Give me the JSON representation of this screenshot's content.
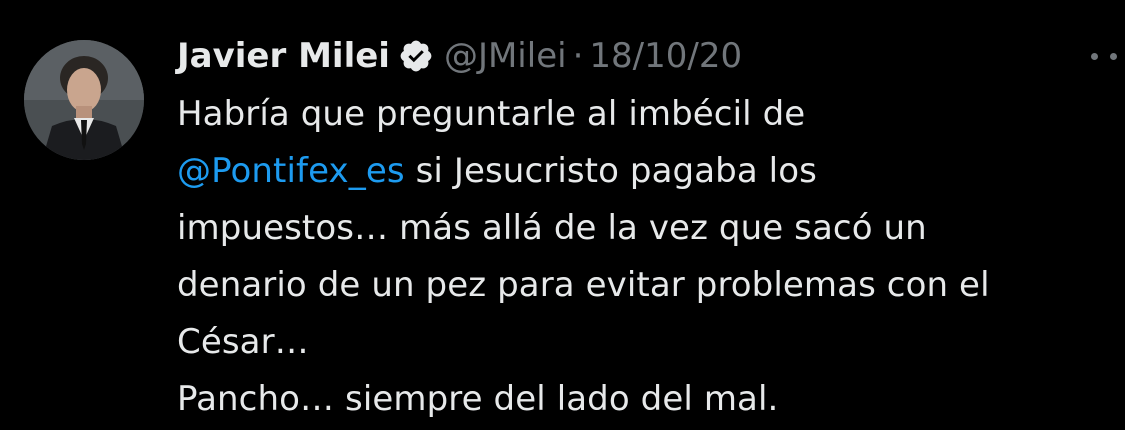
{
  "author": {
    "name": "Javier Milei",
    "handle": "@JMilei",
    "separator": "·",
    "date": "18/10/20",
    "verified_icon": "verified-badge-icon",
    "avatar": "avatar-photo"
  },
  "menu": {
    "icon": "more-options-icon"
  },
  "tweet": {
    "line1": "Habría que preguntarle al imbécil de",
    "line2_mention": "@Pontifex_es",
    "line2_rest": " si Jesucristo pagaba los",
    "line3": "impuestos… más allá de la vez que sacó un",
    "line4": "denario de un pez para evitar problemas con el",
    "line5": "César…",
    "line6": "Pancho… siempre del lado del mal."
  },
  "colors": {
    "background": "#000000",
    "text": "#e7e9ea",
    "secondary": "#71767b",
    "link": "#1d9bf0"
  }
}
